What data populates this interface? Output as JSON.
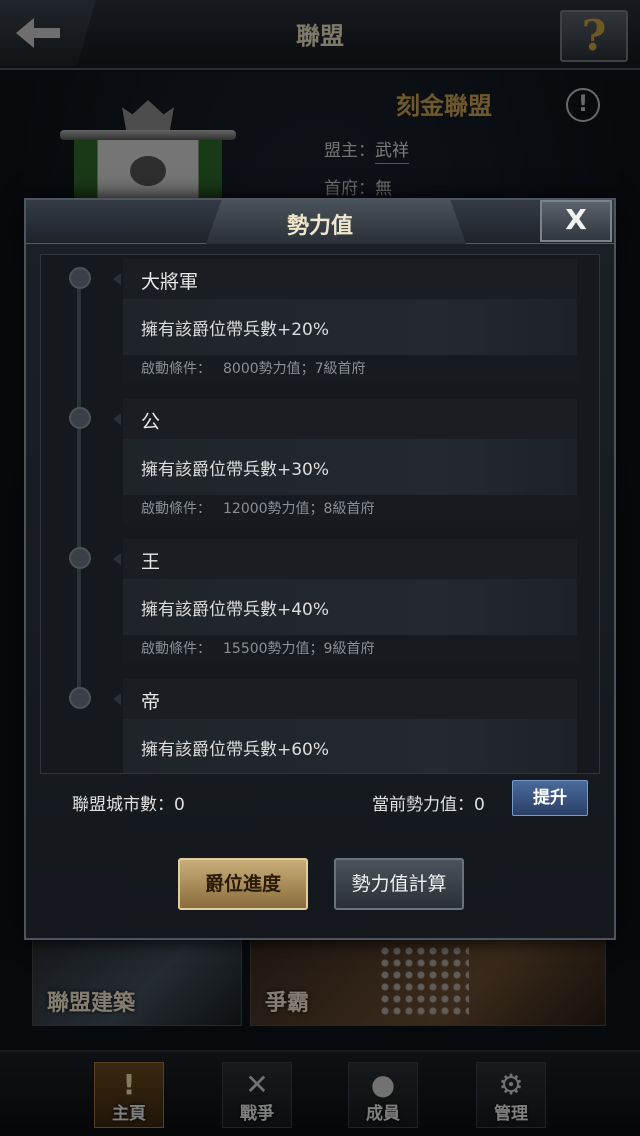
{
  "topbar": {
    "title": "聯盟",
    "help": "?"
  },
  "alliance": {
    "name": "刻金聯盟",
    "leader_label": "盟主：",
    "leader": "武祥",
    "capital_label": "首府：",
    "capital": "無"
  },
  "tiles": [
    {
      "label": "聯盟建築"
    },
    {
      "label": "爭霸"
    }
  ],
  "nav": [
    {
      "label": "主頁",
      "icon": "!"
    },
    {
      "label": "戰爭",
      "icon": "✕"
    },
    {
      "label": "成員",
      "icon": "●"
    },
    {
      "label": "管理",
      "icon": "⚙"
    }
  ],
  "modal": {
    "title": "勢力值",
    "close": "X",
    "ranks": [
      {
        "name": "大將軍",
        "effect": "擁有該爵位帶兵數+20%",
        "cond_label": "啟動條件：",
        "cond": "8000勢力值；7級首府"
      },
      {
        "name": "公",
        "effect": "擁有該爵位帶兵數+30%",
        "cond_label": "啟動條件：",
        "cond": "12000勢力值；8級首府"
      },
      {
        "name": "王",
        "effect": "擁有該爵位帶兵數+40%",
        "cond_label": "啟動條件：",
        "cond": "15500勢力值；9級首府"
      },
      {
        "name": "帝",
        "effect": "擁有該爵位帶兵數+60%"
      }
    ],
    "city_count": "聯盟城市數：0",
    "power_now": "當前勢力值：0",
    "upgrade": "提升",
    "btn_rank": "爵位進度",
    "btn_calc": "勢力值計算"
  }
}
